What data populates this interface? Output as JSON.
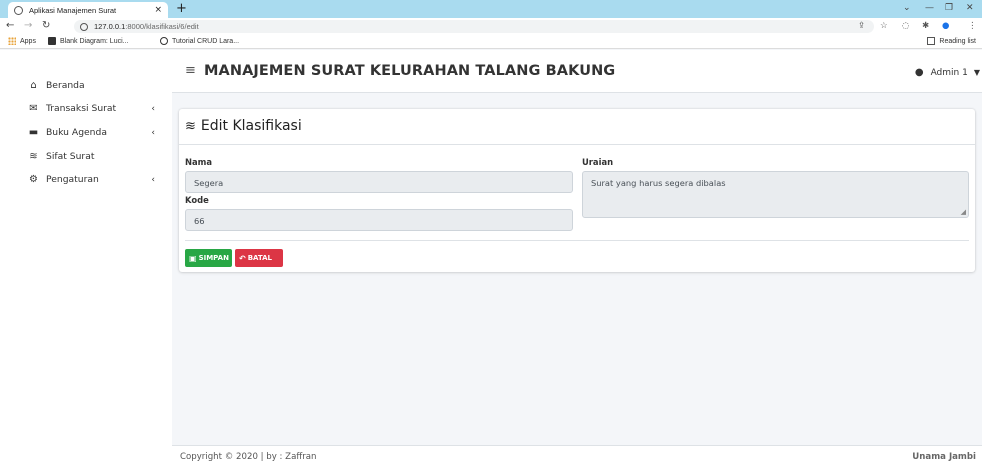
{
  "browser": {
    "tab_title": "Aplikasi Manajemen Surat",
    "tab_close": "×",
    "new_tab": "+",
    "url_host": "127.0.0.1",
    "url_rest": ":8000/klasifikasi/6/edit",
    "bookmarks": [
      {
        "label": "Apps"
      },
      {
        "label": "Blank Diagram: Luci..."
      },
      {
        "label": "Tutorial CRUD Lara..."
      }
    ],
    "reading_list": "Reading list"
  },
  "sidebar": {
    "items": [
      {
        "label": "Beranda",
        "icon": "home-icon",
        "has_children": false
      },
      {
        "label": "Transaksi Surat",
        "icon": "mail-icon",
        "has_children": true
      },
      {
        "label": "Buku Agenda",
        "icon": "book-icon",
        "has_children": true
      },
      {
        "label": "Sifat Surat",
        "icon": "layers-icon",
        "has_children": false
      },
      {
        "label": "Pengaturan",
        "icon": "cogs-icon",
        "has_children": true
      }
    ]
  },
  "header": {
    "title": "MANAJEMEN SURAT KELURAHAN TALANG BAKUNG",
    "user": "Admin 1"
  },
  "form": {
    "title": "Edit Klasifikasi",
    "nama_label": "Nama",
    "nama_value": "Segera",
    "kode_label": "Kode",
    "kode_value": "66",
    "uraian_label": "Uraian",
    "uraian_value": "Surat yang harus segera dibalas",
    "save_label": "SIMPAN",
    "cancel_label": "BATAL"
  },
  "footer": {
    "left": "Copyright © 2020 | by : Zaffran",
    "right": "Unama Jambi"
  },
  "colors": {
    "tabbar": "#a9dbef",
    "save": "#28a745",
    "cancel": "#dc3545"
  }
}
